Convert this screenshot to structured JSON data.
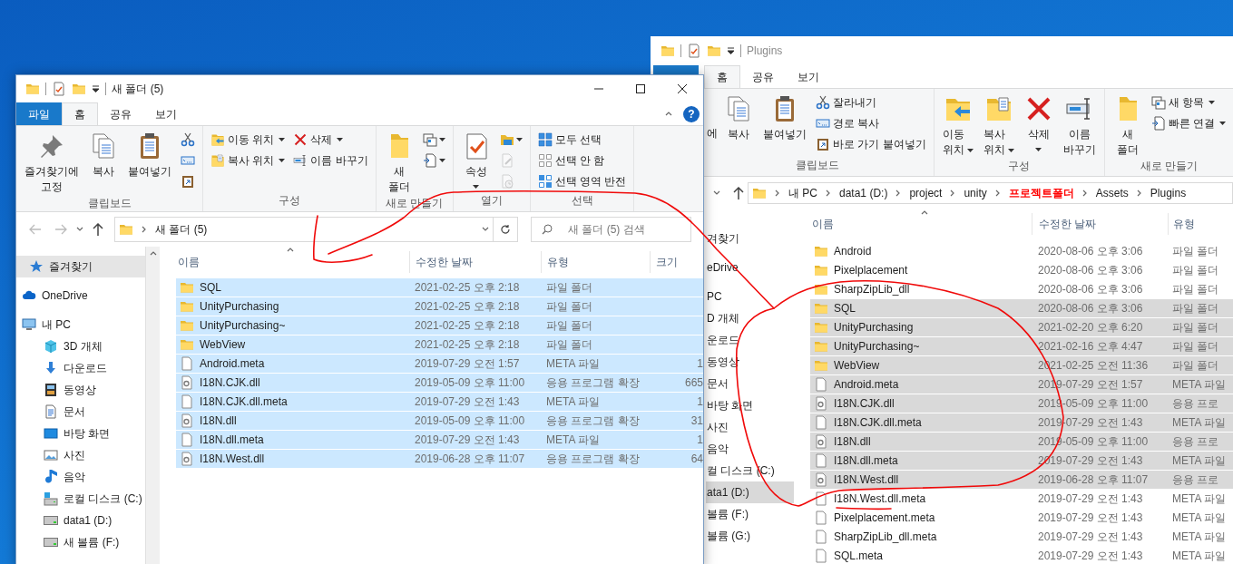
{
  "back_window": {
    "title": "Plugins",
    "tabs": [
      {
        "label": "홈",
        "selected": true
      },
      {
        "label": "공유",
        "selected": false
      },
      {
        "label": "보기",
        "selected": false
      }
    ],
    "ribbon": [
      {
        "label": "클립보드",
        "columns": [
          [
            {
              "label": "에",
              "kind": "fragment"
            }
          ],
          [
            {
              "label": "복사",
              "kind": "large"
            }
          ],
          [
            {
              "label": "붙여넣기",
              "kind": "large"
            }
          ],
          [
            {
              "label": "잘라내기",
              "kind": "small"
            },
            {
              "label": "경로 복사",
              "kind": "small"
            },
            {
              "label": "바로 가기 붙여넣기",
              "kind": "small"
            }
          ]
        ]
      },
      {
        "label": "구성",
        "columns": [
          [
            {
              "label": "이동\n위치",
              "kind": "large",
              "dropdown": true
            }
          ],
          [
            {
              "label": "복사\n위치",
              "kind": "large",
              "dropdown": true
            }
          ],
          [
            {
              "label": "삭제",
              "kind": "large",
              "dropdown": true
            }
          ],
          [
            {
              "label": "이름\n바꾸기",
              "kind": "large",
              "dropdown": false
            }
          ]
        ]
      },
      {
        "label": "새로 만들기",
        "columns": [
          [
            {
              "label": "새\n폴더",
              "kind": "large",
              "dropdown": false
            }
          ],
          [
            {
              "label": "새 항목",
              "kind": "small",
              "dropdown": true
            },
            {
              "label": "빠른 연결",
              "kind": "small",
              "dropdown": true
            }
          ]
        ]
      }
    ],
    "path": [
      {
        "label": "내 PC",
        "highlighted": false
      },
      {
        "label": "data1 (D:)",
        "highlighted": false
      },
      {
        "label": "project",
        "highlighted": false
      },
      {
        "label": "unity",
        "highlighted": false
      },
      {
        "label": "프로젝트폴더",
        "highlighted": true
      },
      {
        "label": "Assets",
        "highlighted": false
      },
      {
        "label": "Plugins",
        "highlighted": false
      }
    ],
    "sidebar": [
      {
        "label": "겨찾기",
        "selected": false
      },
      {
        "label": "eDrive",
        "selected": false
      },
      {
        "label": "PC",
        "selected": false
      },
      {
        "label": "D 개체",
        "selected": false
      },
      {
        "label": "운로드",
        "selected": false
      },
      {
        "label": "동영상",
        "selected": false
      },
      {
        "label": "문서",
        "selected": false
      },
      {
        "label": "바탕 화면",
        "selected": false
      },
      {
        "label": "사진",
        "selected": false
      },
      {
        "label": "음악",
        "selected": false
      },
      {
        "label": "컬 디스크 (C:)",
        "selected": false
      },
      {
        "label": "ata1 (D:)",
        "selected": true
      },
      {
        "label": "볼륨 (F:)",
        "selected": false
      },
      {
        "label": "볼륨 (G:)",
        "selected": false
      }
    ],
    "columns": [
      "이름",
      "수정한 날짜",
      "유형"
    ],
    "rows": [
      {
        "name": "Android",
        "modified": "2020-08-06 오후 3:06",
        "type": "파일 폴더",
        "kind": "folder",
        "selected": false
      },
      {
        "name": "Pixelplacement",
        "modified": "2020-08-06 오후 3:06",
        "type": "파일 폴더",
        "kind": "folder",
        "selected": false
      },
      {
        "name": "SharpZipLib_dll",
        "modified": "2020-08-06 오후 3:06",
        "type": "파일 폴더",
        "kind": "folder",
        "selected": false
      },
      {
        "name": "SQL",
        "modified": "2020-08-06 오후 3:06",
        "type": "파일 폴더",
        "kind": "folder",
        "selected": true
      },
      {
        "name": "UnityPurchasing",
        "modified": "2021-02-20 오후 6:20",
        "type": "파일 폴더",
        "kind": "folder",
        "selected": true
      },
      {
        "name": "UnityPurchasing~",
        "modified": "2021-02-16 오후 4:47",
        "type": "파일 폴더",
        "kind": "folder",
        "selected": true
      },
      {
        "name": "WebView",
        "modified": "2021-02-25 오전 11:36",
        "type": "파일 폴더",
        "kind": "folder",
        "selected": true
      },
      {
        "name": "Android.meta",
        "modified": "2019-07-29 오전 1:57",
        "type": "META 파일",
        "kind": "file",
        "selected": true
      },
      {
        "name": "I18N.CJK.dll",
        "modified": "2019-05-09 오후 11:00",
        "type": "응용 프로",
        "kind": "dll",
        "selected": true
      },
      {
        "name": "I18N.CJK.dll.meta",
        "modified": "2019-07-29 오전 1:43",
        "type": "META 파일",
        "kind": "file",
        "selected": true
      },
      {
        "name": "I18N.dll",
        "modified": "2019-05-09 오후 11:00",
        "type": "응용 프로",
        "kind": "dll",
        "selected": true
      },
      {
        "name": "I18N.dll.meta",
        "modified": "2019-07-29 오전 1:43",
        "type": "META 파일",
        "kind": "file",
        "selected": true
      },
      {
        "name": "I18N.West.dll",
        "modified": "2019-06-28 오후 11:07",
        "type": "응용 프로",
        "kind": "dll",
        "selected": true
      },
      {
        "name": "I18N.West.dll.meta",
        "modified": "2019-07-29 오전 1:43",
        "type": "META 파일",
        "kind": "file",
        "selected": false
      },
      {
        "name": "Pixelplacement.meta",
        "modified": "2019-07-29 오전 1:43",
        "type": "META 파일",
        "kind": "file",
        "selected": false
      },
      {
        "name": "SharpZipLib_dll.meta",
        "modified": "2019-07-29 오전 1:43",
        "type": "META 파일",
        "kind": "file",
        "selected": false
      },
      {
        "name": "SQL.meta",
        "modified": "2019-07-29 오전 1:43",
        "type": "META 파일",
        "kind": "file",
        "selected": false
      }
    ]
  },
  "front_window": {
    "title": "새 폴더 (5)",
    "tabs": [
      {
        "label": "파일",
        "kind": "file",
        "selected": false
      },
      {
        "label": "홈",
        "kind": "tab",
        "selected": true
      },
      {
        "label": "공유",
        "kind": "tab",
        "selected": false
      },
      {
        "label": "보기",
        "kind": "tab",
        "selected": false
      }
    ],
    "help": "?",
    "ribbon": [
      {
        "label": "클립보드",
        "columns": [
          [
            {
              "label": "즐겨찾기에\n고정",
              "kind": "large",
              "dropdown": false
            }
          ],
          [
            {
              "label": "복사",
              "kind": "large",
              "dropdown": false
            }
          ],
          [
            {
              "label": "붙여넣기",
              "kind": "large",
              "dropdown": false
            }
          ],
          [
            {
              "kind": "icon",
              "dropdown": false,
              "disabled": false
            },
            {
              "kind": "icon",
              "dropdown": false,
              "disabled": false
            },
            {
              "kind": "icon",
              "dropdown": false,
              "disabled": false
            }
          ]
        ]
      },
      {
        "label": "구성",
        "columns": [
          [
            {
              "label": "이동 위치",
              "kind": "small",
              "dropdown": true
            },
            {
              "label": "복사 위치",
              "kind": "small",
              "dropdown": true
            }
          ],
          [
            {
              "label": "삭제",
              "kind": "small",
              "dropdown": true
            },
            {
              "label": "이름 바꾸기",
              "kind": "small",
              "dropdown": false
            }
          ]
        ]
      },
      {
        "label": "새로 만들기",
        "columns": [
          [
            {
              "label": "새\n폴더",
              "kind": "large",
              "dropdown": false
            }
          ],
          [
            {
              "kind": "icon",
              "dropdown": true,
              "disabled": false
            },
            {
              "kind": "icon",
              "dropdown": true,
              "disabled": false
            }
          ]
        ]
      },
      {
        "label": "열기",
        "columns": [
          [
            {
              "label": "속성",
              "kind": "large",
              "dropdown": true
            }
          ],
          [
            {
              "kind": "icon",
              "dropdown": true,
              "disabled": false
            },
            {
              "kind": "icon",
              "dropdown": false,
              "disabled": true
            },
            {
              "kind": "icon",
              "dropdown": false,
              "disabled": true
            }
          ]
        ]
      },
      {
        "label": "선택",
        "columns": [
          [
            {
              "label": "모두 선택",
              "kind": "small",
              "dropdown": false
            },
            {
              "label": "선택 안 함",
              "kind": "small",
              "dropdown": false
            },
            {
              "label": "선택 영역 반전",
              "kind": "small",
              "dropdown": false
            }
          ]
        ]
      }
    ],
    "path": [
      "새 폴더 (5)"
    ],
    "search_placeholder": "새 폴더 (5) 검색",
    "sidebar": [
      {
        "label": "즐겨찾기",
        "kind": "favorites",
        "selected": true
      },
      {
        "label": "OneDrive",
        "kind": "cloud",
        "selected": false
      },
      {
        "label": "내 PC",
        "kind": "pc",
        "selected": false
      },
      {
        "label": "3D 개체",
        "kind": "objects",
        "selected": false
      },
      {
        "label": "다운로드",
        "kind": "downloads",
        "selected": false
      },
      {
        "label": "동영상",
        "kind": "videos",
        "selected": false
      },
      {
        "label": "문서",
        "kind": "documents",
        "selected": false
      },
      {
        "label": "바탕 화면",
        "kind": "desktop",
        "selected": false
      },
      {
        "label": "사진",
        "kind": "pictures",
        "selected": false
      },
      {
        "label": "음악",
        "kind": "music",
        "selected": false
      },
      {
        "label": "로컬 디스크 (C:)",
        "kind": "system_drive",
        "selected": false
      },
      {
        "label": "data1 (D:)",
        "kind": "drive",
        "selected": false
      },
      {
        "label": "새 볼륨 (F:)",
        "kind": "drive",
        "selected": false
      }
    ],
    "columns": [
      "이름",
      "수정한 날짜",
      "유형",
      "크기"
    ],
    "rows": [
      {
        "name": "SQL",
        "modified": "2021-02-25 오후 2:18",
        "type": "파일 폴더",
        "kind": "folder",
        "selected": true
      },
      {
        "name": "UnityPurchasing",
        "modified": "2021-02-25 오후 2:18",
        "type": "파일 폴더",
        "kind": "folder",
        "selected": true
      },
      {
        "name": "UnityPurchasing~",
        "modified": "2021-02-25 오후 2:18",
        "type": "파일 폴더",
        "kind": "folder",
        "selected": true
      },
      {
        "name": "WebView",
        "modified": "2021-02-25 오후 2:18",
        "type": "파일 폴더",
        "kind": "folder",
        "selected": true
      },
      {
        "name": "Android.meta",
        "modified": "2019-07-29 오전 1:57",
        "type": "META 파일",
        "size": "1",
        "kind": "file",
        "selected": true
      },
      {
        "name": "I18N.CJK.dll",
        "modified": "2019-05-09 오후 11:00",
        "type": "응용 프로그램 확장",
        "size": "665",
        "kind": "dll",
        "selected": true
      },
      {
        "name": "I18N.CJK.dll.meta",
        "modified": "2019-07-29 오전 1:43",
        "type": "META 파일",
        "size": "1",
        "kind": "file",
        "selected": true
      },
      {
        "name": "I18N.dll",
        "modified": "2019-05-09 오후 11:00",
        "type": "응용 프로그램 확장",
        "size": "31",
        "kind": "dll",
        "selected": true
      },
      {
        "name": "I18N.dll.meta",
        "modified": "2019-07-29 오전 1:43",
        "type": "META 파일",
        "size": "1",
        "kind": "file",
        "selected": true
      },
      {
        "name": "I18N.West.dll",
        "modified": "2019-06-28 오후 11:07",
        "type": "응용 프로그램 확장",
        "size": "64",
        "kind": "dll",
        "selected": true
      }
    ]
  }
}
